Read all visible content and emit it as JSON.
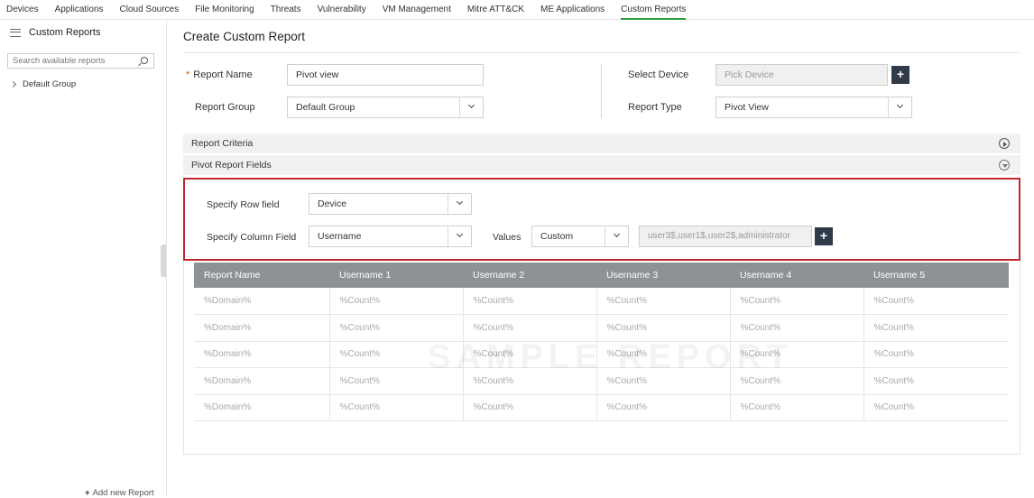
{
  "topnav": {
    "tabs": [
      {
        "label": "Devices"
      },
      {
        "label": "Applications"
      },
      {
        "label": "Cloud Sources"
      },
      {
        "label": "File Monitoring"
      },
      {
        "label": "Threats"
      },
      {
        "label": "Vulnerability"
      },
      {
        "label": "VM Management"
      },
      {
        "label": "Mitre ATT&CK"
      },
      {
        "label": "ME Applications"
      },
      {
        "label": "Custom Reports"
      }
    ],
    "active_tab": "Custom Reports",
    "accent_color": "#2e9e3f"
  },
  "sidebar": {
    "title": "Custom Reports",
    "search_placeholder": "Search available reports",
    "group_label": "Default Group",
    "add_label": "Add new Report"
  },
  "main": {
    "title": "Create Custom Report",
    "form": {
      "report_name_label": "Report Name",
      "report_name_value": "Pivot view",
      "report_group_label": "Report Group",
      "report_group_value": "Default Group",
      "select_device_label": "Select Device",
      "select_device_placeholder": "Pick Device",
      "report_type_label": "Report Type",
      "report_type_value": "Pivot View"
    },
    "sections": {
      "criteria_label": "Report Criteria",
      "pivot_fields_label": "Pivot Report Fields"
    },
    "pivot": {
      "row_field_label": "Specify Row field",
      "row_field_value": "Device",
      "column_field_label": "Specify Column Field",
      "column_field_value": "Username",
      "values_label": "Values",
      "values_value": "Custom",
      "values_input": "user3$,user1$,user2$,administrator"
    },
    "table": {
      "headers": [
        "Report Name",
        "Username 1",
        "Username 2",
        "Username 3",
        "Username 4",
        "Username 5"
      ],
      "rows": [
        [
          "%Domain%",
          "%Count%",
          "%Count%",
          "%Count%",
          "%Count%",
          "%Count%"
        ],
        [
          "%Domain%",
          "%Count%",
          "%Count%",
          "%Count%",
          "%Count%",
          "%Count%"
        ],
        [
          "%Domain%",
          "%Count%",
          "%Count%",
          "%Count%",
          "%Count%",
          "%Count%"
        ],
        [
          "%Domain%",
          "%Count%",
          "%Count%",
          "%Count%",
          "%Count%",
          "%Count%"
        ],
        [
          "%Domain%",
          "%Count%",
          "%Count%",
          "%Count%",
          "%Count%",
          "%Count%"
        ]
      ],
      "watermark": "SAMPLE REPORT"
    },
    "highlight_color": "#c0272d"
  }
}
